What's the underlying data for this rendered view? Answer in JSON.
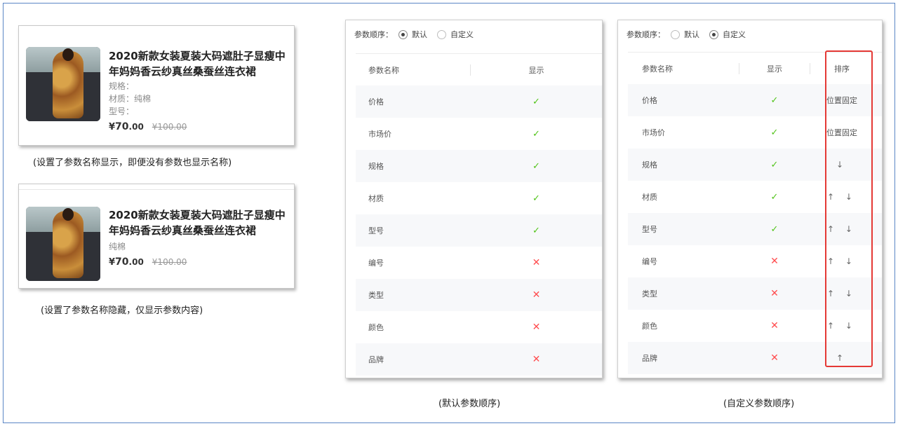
{
  "card1": {
    "title": "2020新款女装夏装大码遮肚子显瘦中年妈妈香云纱真丝桑蚕丝连衣裙",
    "spec_lines": [
      "规格：",
      "材质：纯棉",
      "型号："
    ],
    "price_symbol": "¥",
    "price_int": "70",
    "price_dec": ".00",
    "price_old": "¥100.00",
    "caption": "(设置了参数名称显示，即便没有参数也显示名称)"
  },
  "card2": {
    "title": "2020新款女装夏装大码遮肚子显瘦中年妈妈香云纱真丝桑蚕丝连衣裙",
    "spec_lines": [
      "纯棉"
    ],
    "price_symbol": "¥",
    "price_int": "70",
    "price_dec": ".00",
    "price_old": "¥100.00",
    "caption": "(设置了参数名称隐藏，仅显示参数内容)"
  },
  "panelA": {
    "order_label": "参数顺序：",
    "options": [
      "默认",
      "自定义"
    ],
    "selected": 0,
    "headers": {
      "name": "参数名称",
      "show": "显示"
    },
    "rows": [
      {
        "name": "价格",
        "show": true
      },
      {
        "name": "市场价",
        "show": true
      },
      {
        "name": "规格",
        "show": true
      },
      {
        "name": "材质",
        "show": true
      },
      {
        "name": "型号",
        "show": true
      },
      {
        "name": "编号",
        "show": false
      },
      {
        "name": "类型",
        "show": false
      },
      {
        "name": "颜色",
        "show": false
      },
      {
        "name": "品牌",
        "show": false
      }
    ],
    "caption": "(默认参数顺序)"
  },
  "panelB": {
    "order_label": "参数顺序：",
    "options": [
      "默认",
      "自定义"
    ],
    "selected": 1,
    "headers": {
      "name": "参数名称",
      "show": "显示",
      "sort": "排序"
    },
    "rows": [
      {
        "name": "价格",
        "show": true,
        "sort": "位置固定"
      },
      {
        "name": "市场价",
        "show": true,
        "sort": "位置固定"
      },
      {
        "name": "规格",
        "show": true,
        "sort": "↓"
      },
      {
        "name": "材质",
        "show": true,
        "sort": "↑ ↓"
      },
      {
        "name": "型号",
        "show": true,
        "sort": "↑ ↓"
      },
      {
        "name": "编号",
        "show": false,
        "sort": "↑ ↓"
      },
      {
        "name": "类型",
        "show": false,
        "sort": "↑ ↓"
      },
      {
        "name": "颜色",
        "show": false,
        "sort": "↑ ↓"
      },
      {
        "name": "品牌",
        "show": false,
        "sort": "↑"
      }
    ],
    "caption": "(自定义参数顺序)"
  },
  "icons": {
    "check": "✓",
    "cross": "✕",
    "check_color": "#52c41a",
    "cross_color": "#ff4d4f",
    "highlight_color": "#e53935"
  }
}
